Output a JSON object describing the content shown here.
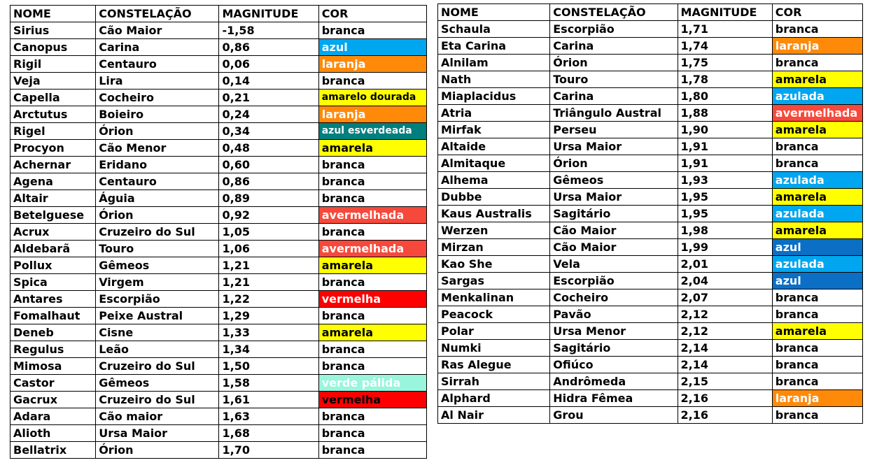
{
  "headers": [
    "NOME",
    "CONSTELAÇÃO",
    "MAGNITUDE",
    "COR"
  ],
  "colors": {
    "azul": "#00a6ef",
    "laranja": "#ff8a0a",
    "amarelo": "#ffff00",
    "verde_escuro": "#007f7f",
    "vermelho_claro": "#f7493b",
    "vermelho": "#ff0000",
    "verde_palida": "#99f5dc",
    "azul_escuro": "#0a6fc5"
  },
  "left": [
    {
      "nome": "Sirius",
      "constelacao": "Cão Maior",
      "magnitude": "-1,58",
      "cor": "branca",
      "bg": "",
      "fg": "#000000"
    },
    {
      "nome": "Canopus",
      "constelacao": "Carina",
      "magnitude": "0,86",
      "cor": "azul",
      "bg": "#00a6ef",
      "fg": "#ffffff"
    },
    {
      "nome": "Rigil",
      "constelacao": "Centauro",
      "magnitude": "0,06",
      "cor": "laranja",
      "bg": "#ff8a0a",
      "fg": "#ffffff"
    },
    {
      "nome": "Veja",
      "constelacao": "Lira",
      "magnitude": "0,14",
      "cor": "branca",
      "bg": "",
      "fg": "#000000"
    },
    {
      "nome": "Capella",
      "constelacao": "Cocheiro",
      "magnitude": "0,21",
      "cor": "amarelo dourada",
      "bg": "#ffff00",
      "fg": "#000000",
      "small": true
    },
    {
      "nome": "Arctutus",
      "constelacao": "Boieiro",
      "magnitude": "0,24",
      "cor": "laranja",
      "bg": "#ff8a0a",
      "fg": "#ffffff"
    },
    {
      "nome": "Rigel",
      "constelacao": "Órion",
      "magnitude": "0,34",
      "cor": "azul esverdeada",
      "bg": "#007f7f",
      "fg": "#ffffff",
      "small": true
    },
    {
      "nome": "Procyon",
      "constelacao": "Cão Menor",
      "magnitude": "0,48",
      "cor": "amarela",
      "bg": "#ffff00",
      "fg": "#000000"
    },
    {
      "nome": "Achernar",
      "constelacao": "Eridano",
      "magnitude": "0,60",
      "cor": "branca",
      "bg": "",
      "fg": "#000000"
    },
    {
      "nome": "Agena",
      "constelacao": "Centauro",
      "magnitude": "0,86",
      "cor": "branca",
      "bg": "",
      "fg": "#000000"
    },
    {
      "nome": "Altair",
      "constelacao": "Águia",
      "magnitude": "0,89",
      "cor": "branca",
      "bg": "",
      "fg": "#000000"
    },
    {
      "nome": "Betelguese",
      "constelacao": "Órion",
      "magnitude": "0,92",
      "cor": "avermelhada",
      "bg": "#f7493b",
      "fg": "#ffffff"
    },
    {
      "nome": "Acrux",
      "constelacao": "Cruzeiro do Sul",
      "magnitude": "1,05",
      "cor": "branca",
      "bg": "",
      "fg": "#000000"
    },
    {
      "nome": "Aldebarã",
      "constelacao": "Touro",
      "magnitude": "1,06",
      "cor": "avermelhada",
      "bg": "#f7493b",
      "fg": "#ffffff"
    },
    {
      "nome": "Pollux",
      "constelacao": "Gêmeos",
      "magnitude": "1,21",
      "cor": "amarela",
      "bg": "#ffff00",
      "fg": "#000000"
    },
    {
      "nome": "Spica",
      "constelacao": "Virgem",
      "magnitude": "1,21",
      "cor": "branca",
      "bg": "",
      "fg": "#000000"
    },
    {
      "nome": "Antares",
      "constelacao": "Escorpião",
      "magnitude": "1,22",
      "cor": "vermelha",
      "bg": "#ff0000",
      "fg": "#ffffff"
    },
    {
      "nome": "Fomalhaut",
      "constelacao": "Peixe Austral",
      "magnitude": "1,29",
      "cor": "branca",
      "bg": "",
      "fg": "#000000"
    },
    {
      "nome": "Deneb",
      "constelacao": "Cisne",
      "magnitude": "1,33",
      "cor": "amarela",
      "bg": "#ffff00",
      "fg": "#000000"
    },
    {
      "nome": "Regulus",
      "constelacao": "Leão",
      "magnitude": "1,34",
      "cor": "branca",
      "bg": "",
      "fg": "#000000"
    },
    {
      "nome": "Mimosa",
      "constelacao": "Cruzeiro do Sul",
      "magnitude": "1,50",
      "cor": "branca",
      "bg": "",
      "fg": "#000000"
    },
    {
      "nome": "Castor",
      "constelacao": "Gêmeos",
      "magnitude": "1,58",
      "cor": "verde pálida",
      "bg": "#99f5dc",
      "fg": "#ffffff"
    },
    {
      "nome": "Gacrux",
      "constelacao": "Cruzeiro do Sul",
      "magnitude": "1,61",
      "cor": "vermelha",
      "bg": "#ff0000",
      "fg": "#000000"
    },
    {
      "nome": "Adara",
      "constelacao": "Cão maior",
      "magnitude": "1,63",
      "cor": "branca",
      "bg": "",
      "fg": "#000000"
    },
    {
      "nome": "Alioth",
      "constelacao": "Ursa Maior",
      "magnitude": "1,68",
      "cor": "branca",
      "bg": "",
      "fg": "#000000"
    },
    {
      "nome": "Bellatrix",
      "constelacao": "Órion",
      "magnitude": "1,70",
      "cor": "branca",
      "bg": "",
      "fg": "#000000"
    }
  ],
  "right": [
    {
      "nome": "Schaula",
      "constelacao": "Escorpião",
      "magnitude": "1,71",
      "cor": "branca",
      "bg": "",
      "fg": "#000000"
    },
    {
      "nome": "Eta Carina",
      "constelacao": "Carina",
      "magnitude": "1,74",
      "cor": "laranja",
      "bg": "#ff8a0a",
      "fg": "#ffffff"
    },
    {
      "nome": "Alnilam",
      "constelacao": "Órion",
      "magnitude": "1,75",
      "cor": "branca",
      "bg": "",
      "fg": "#000000"
    },
    {
      "nome": "Nath",
      "constelacao": "Touro",
      "magnitude": "1,78",
      "cor": "amarela",
      "bg": "#ffff00",
      "fg": "#000000"
    },
    {
      "nome": "Miaplacidus",
      "constelacao": "Carina",
      "magnitude": "1,80",
      "cor": "azulada",
      "bg": "#00a6ef",
      "fg": "#ffffff"
    },
    {
      "nome": "Atria",
      "constelacao": "Triângulo Austral",
      "magnitude": "1,88",
      "cor": "avermelhada",
      "bg": "#f7493b",
      "fg": "#ffffff"
    },
    {
      "nome": "Mirfak",
      "constelacao": "Perseu",
      "magnitude": "1,90",
      "cor": "amarela",
      "bg": "#ffff00",
      "fg": "#000000"
    },
    {
      "nome": "Altaide",
      "constelacao": "Ursa Maior",
      "magnitude": "1,91",
      "cor": "branca",
      "bg": "",
      "fg": "#000000"
    },
    {
      "nome": "Almitaque",
      "constelacao": "Órion",
      "magnitude": "1,91",
      "cor": "branca",
      "bg": "",
      "fg": "#000000"
    },
    {
      "nome": "Alhema",
      "constelacao": "Gêmeos",
      "magnitude": "1,93",
      "cor": "azulada",
      "bg": "#00a6ef",
      "fg": "#ffffff"
    },
    {
      "nome": "Dubbe",
      "constelacao": "Ursa Maior",
      "magnitude": "1,95",
      "cor": "amarela",
      "bg": "#ffff00",
      "fg": "#000000"
    },
    {
      "nome": "Kaus Australis",
      "constelacao": "Sagitário",
      "magnitude": "1,95",
      "cor": "azulada",
      "bg": "#00a6ef",
      "fg": "#ffffff"
    },
    {
      "nome": "Werzen",
      "constelacao": "Cão Maior",
      "magnitude": "1,98",
      "cor": "amarela",
      "bg": "#ffff00",
      "fg": "#000000"
    },
    {
      "nome": "Mirzan",
      "constelacao": "Cão Maior",
      "magnitude": "1,99",
      "cor": "azul",
      "bg": "#0a6fc5",
      "fg": "#ffffff"
    },
    {
      "nome": "Kao She",
      "constelacao": "Vela",
      "magnitude": "2,01",
      "cor": "azulada",
      "bg": "#00a6ef",
      "fg": "#ffffff"
    },
    {
      "nome": "Sargas",
      "constelacao": "Escorpião",
      "magnitude": "2,04",
      "cor": "azul",
      "bg": "#0a6fc5",
      "fg": "#ffffff"
    },
    {
      "nome": "Menkalinan",
      "constelacao": "Cocheiro",
      "magnitude": "2,07",
      "cor": "branca",
      "bg": "",
      "fg": "#000000"
    },
    {
      "nome": "Peacock",
      "constelacao": "Pavão",
      "magnitude": "2,12",
      "cor": "branca",
      "bg": "",
      "fg": "#000000"
    },
    {
      "nome": "Polar",
      "constelacao": "Ursa Menor",
      "magnitude": "2,12",
      "cor": "amarela",
      "bg": "#ffff00",
      "fg": "#000000"
    },
    {
      "nome": "Numki",
      "constelacao": "Sagitário",
      "magnitude": "2,14",
      "cor": "branca",
      "bg": "",
      "fg": "#000000"
    },
    {
      "nome": "Ras Alegue",
      "constelacao": "Ofiúco",
      "magnitude": "2,14",
      "cor": "branca",
      "bg": "",
      "fg": "#000000"
    },
    {
      "nome": "Sirrah",
      "constelacao": "Andrômeda",
      "magnitude": "2,15",
      "cor": "branca",
      "bg": "",
      "fg": "#000000"
    },
    {
      "nome": "Alphard",
      "constelacao": "Hidra Fêmea",
      "magnitude": "2,16",
      "cor": "laranja",
      "bg": "#ff8a0a",
      "fg": "#ffffff"
    },
    {
      "nome": "Al Nair",
      "constelacao": "Grou",
      "magnitude": "2,16",
      "cor": "branca",
      "bg": "",
      "fg": "#000000"
    }
  ]
}
